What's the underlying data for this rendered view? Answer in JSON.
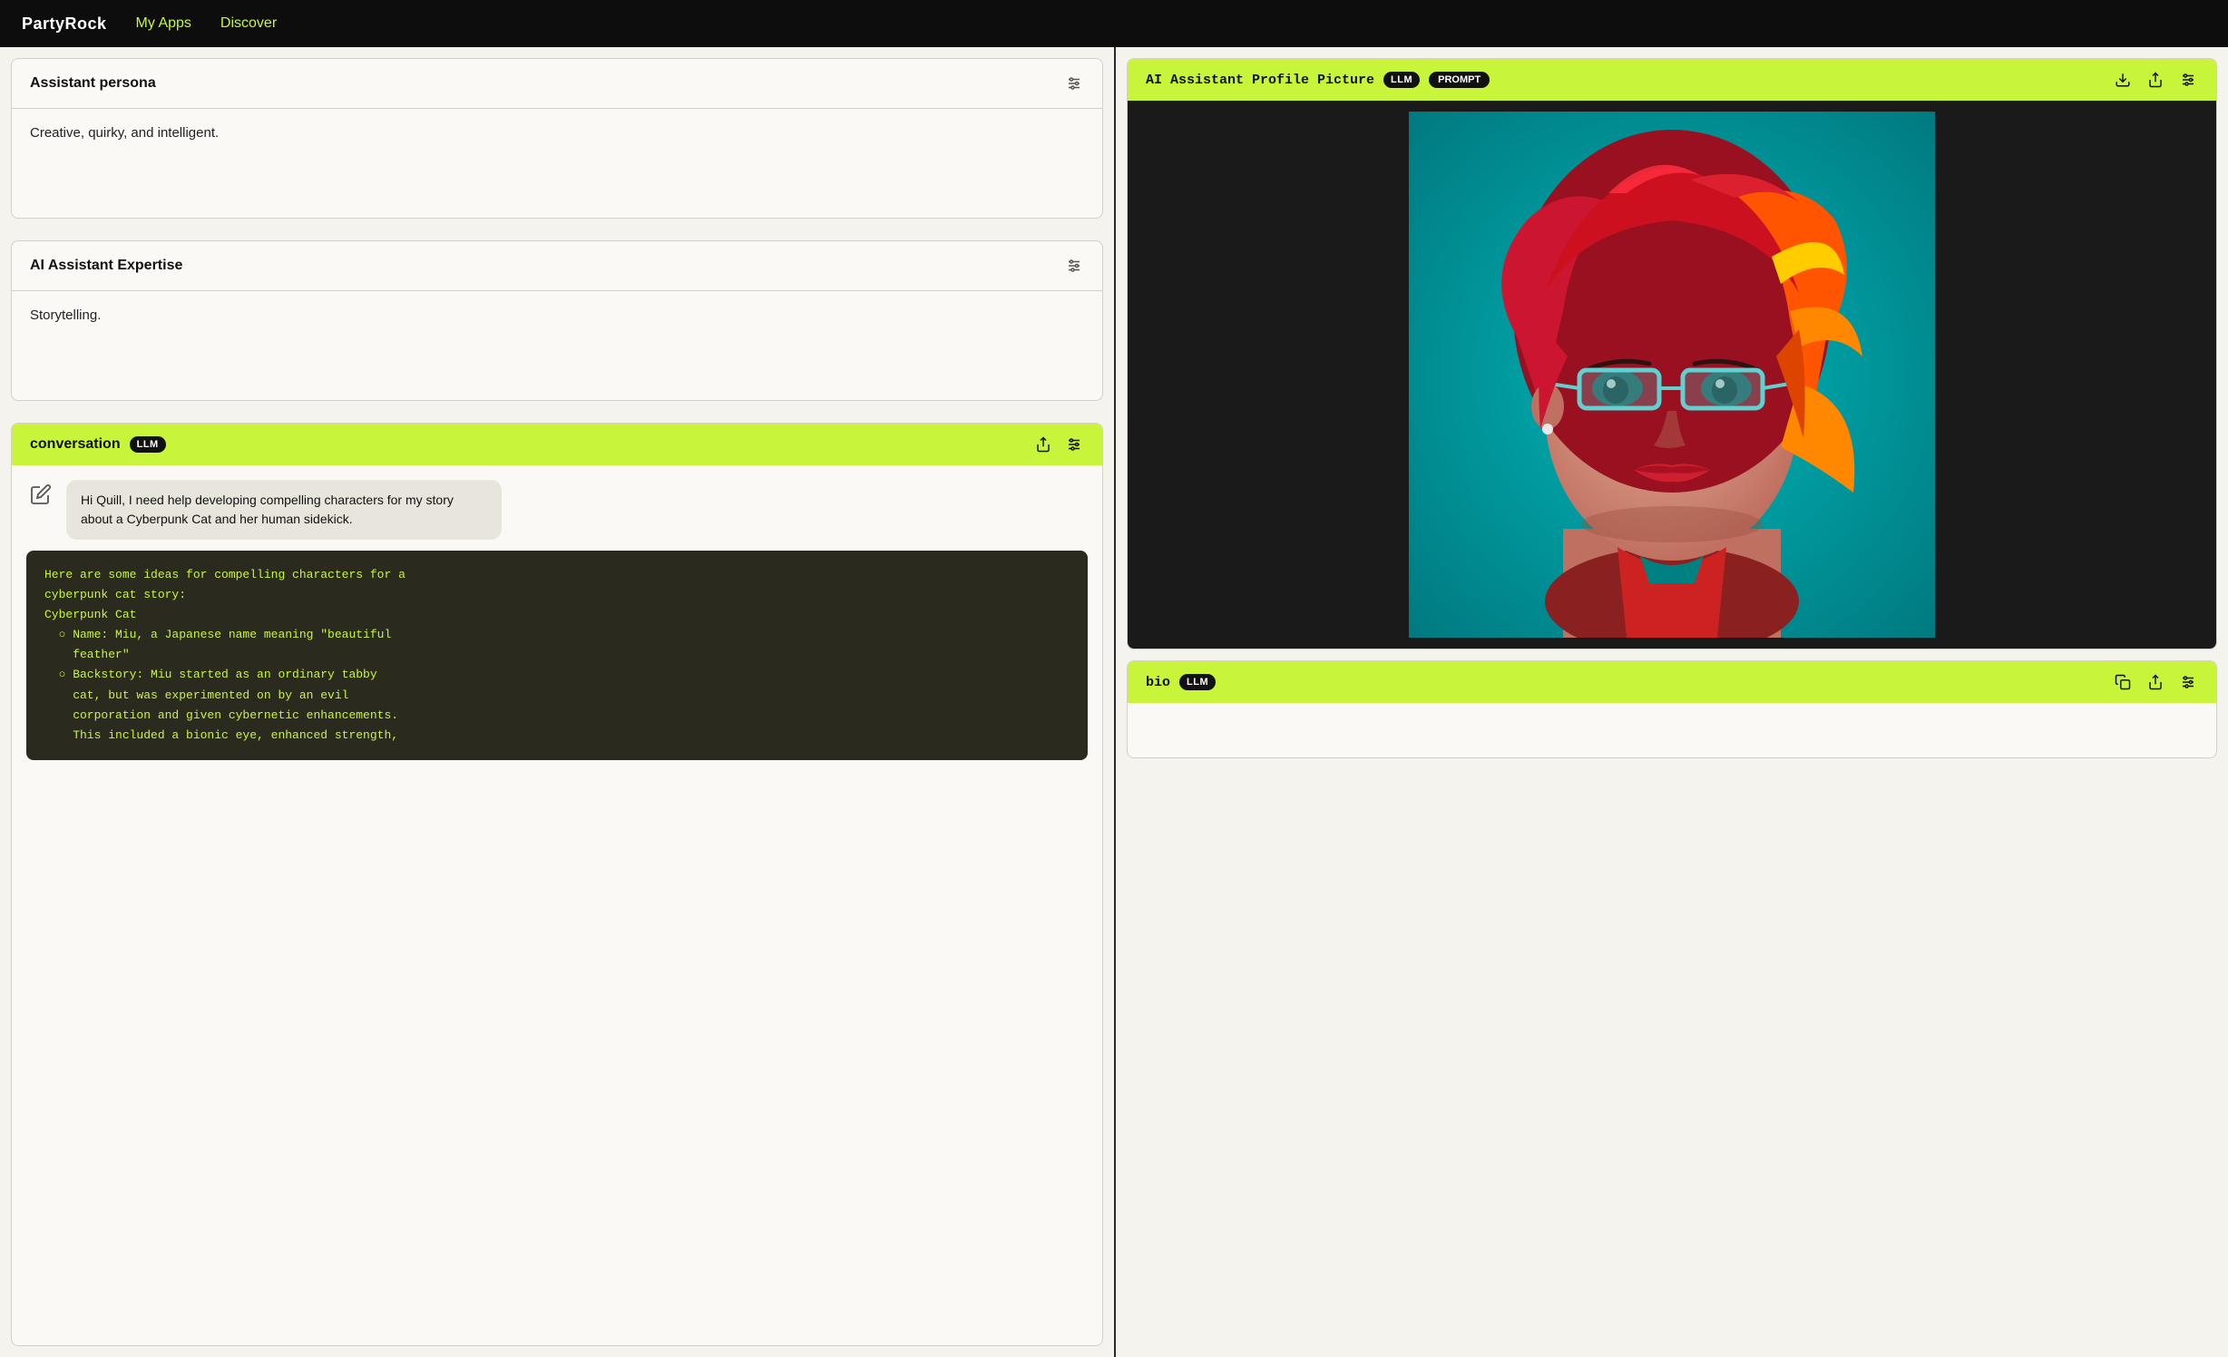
{
  "nav": {
    "logo": "PartyRock",
    "links": [
      {
        "label": "My Apps",
        "href": "#"
      },
      {
        "label": "Discover",
        "href": "#"
      }
    ]
  },
  "left": {
    "persona_widget": {
      "title": "Assistant persona",
      "value": "Creative, quirky, and intelligent.",
      "settings_tooltip": "Settings"
    },
    "expertise_widget": {
      "title": "AI Assistant Expertise",
      "value": "Storytelling.",
      "settings_tooltip": "Settings"
    },
    "conversation_widget": {
      "title": "conversation",
      "badge": "LLM",
      "user_message": "Hi Quill, I need help developing compelling characters for my story about a Cyberpunk Cat and her human sidekick.",
      "ai_response_lines": [
        "Here are some ideas for compelling characters for a",
        "cyberpunk cat story:",
        "Cyberpunk Cat",
        "",
        "  ○ Name: Miu, a Japanese name meaning \"beautiful",
        "    feather\"",
        "  ○ Backstory: Miu started as an ordinary tabby",
        "    cat, but was experimented on by an evil",
        "    corporation and given cybernetic enhancements.",
        "    This included a bionic eye, enhanced strength,"
      ]
    }
  },
  "right": {
    "image_widget": {
      "title": "AI Assistant Profile Picture",
      "badge_llm": "LLM",
      "badge_prompt": "PROMPT",
      "download_tooltip": "Download",
      "share_tooltip": "Share",
      "settings_tooltip": "Settings"
    },
    "bio_widget": {
      "title": "bio",
      "badge": "LLM",
      "copy_tooltip": "Copy",
      "share_tooltip": "Share",
      "settings_tooltip": "Settings"
    }
  },
  "colors": {
    "lime": "#c8f53a",
    "dark": "#0d0d0d",
    "badge_bg": "#111111"
  }
}
